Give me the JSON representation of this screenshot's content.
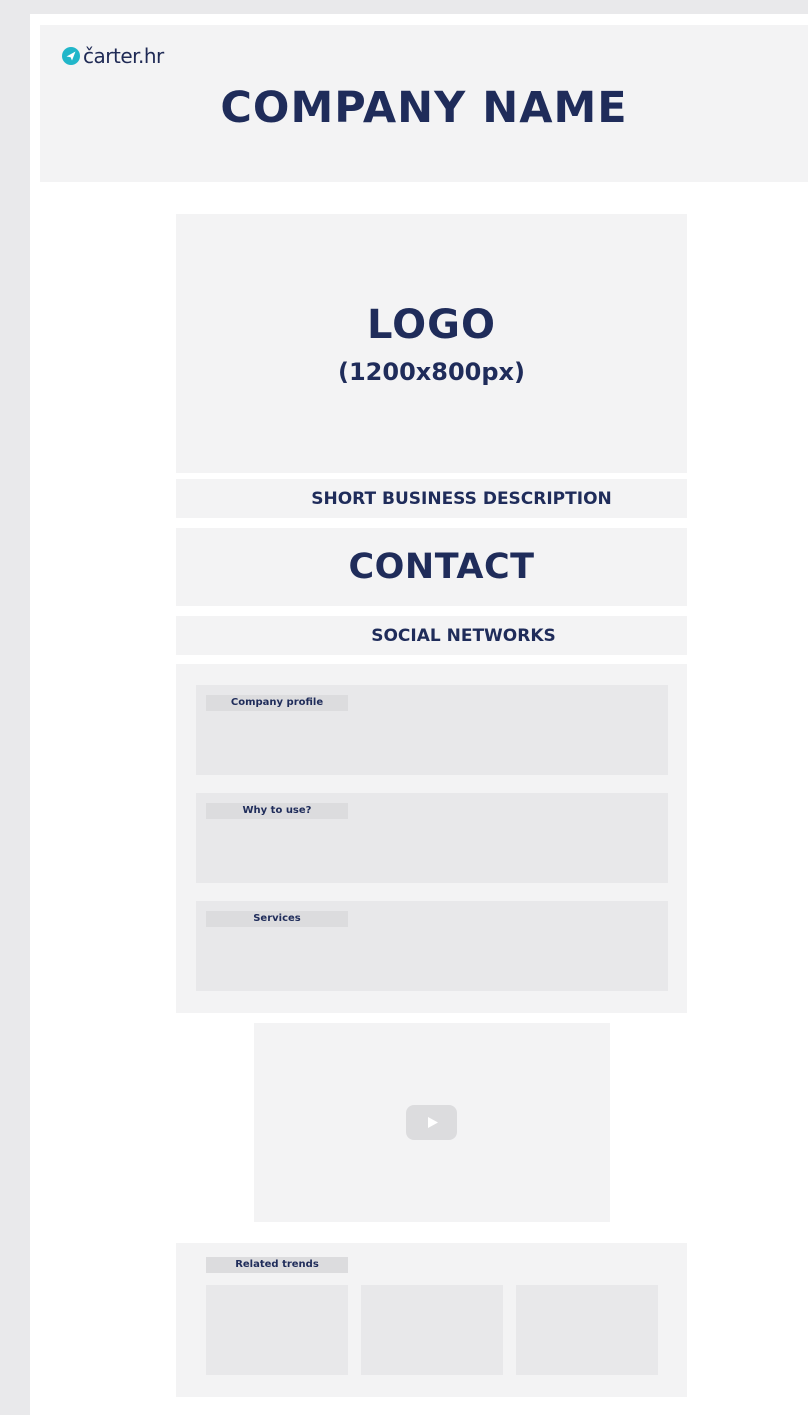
{
  "brand": {
    "name": "čarter.hr",
    "icon": "paper-plane-icon",
    "accent": "#21b6c9"
  },
  "header": {
    "company_name": "COMPANY NAME"
  },
  "logo": {
    "title": "LOGO",
    "size": "(1200x800px)"
  },
  "short_description": "SHORT BUSINESS DESCRIPTION",
  "contact": "CONTACT",
  "social_networks": "SOCIAL NETWORKS",
  "sections": [
    {
      "label": "Company profile"
    },
    {
      "label": "Why to use?"
    },
    {
      "label": "Services"
    }
  ],
  "video": {
    "icon": "play-icon"
  },
  "trends": {
    "label": "Related trends",
    "cards": 3
  },
  "colors": {
    "text_primary": "#1f2c5a",
    "panel": "#f3f3f4",
    "inner_panel": "#e8e8ea"
  }
}
